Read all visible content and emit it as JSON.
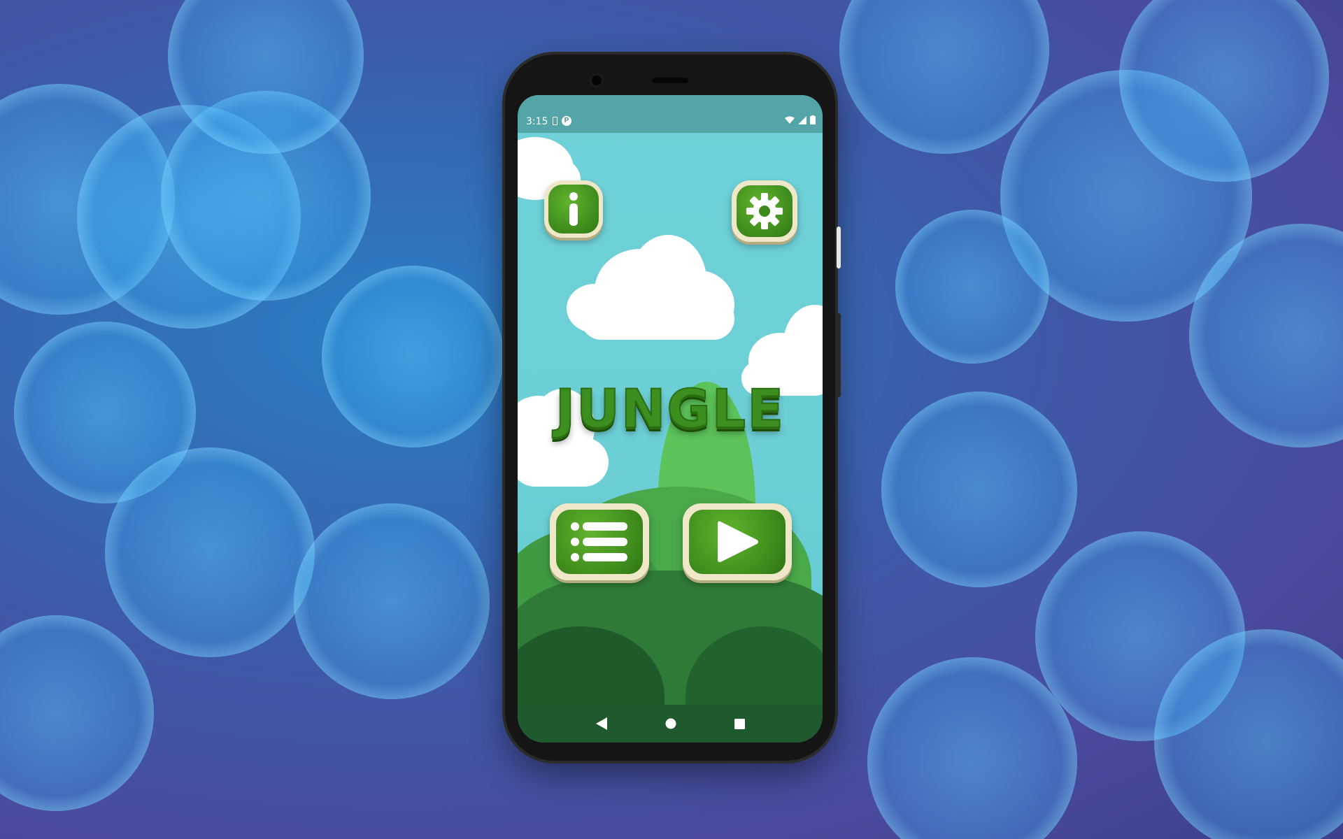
{
  "status_bar": {
    "time": "3:15",
    "notification_badge": "P"
  },
  "game": {
    "title": "JUNGLE",
    "buttons": {
      "info": "info-icon",
      "settings": "gear-icon",
      "levels": "list-icon",
      "play": "play-icon"
    }
  },
  "nav_bar": {
    "back": "back-triangle-icon",
    "home": "home-circle-icon",
    "recents": "recents-square-icon"
  },
  "colors": {
    "sky": "#6fd0d8",
    "button_green": "#3d8a1c",
    "button_frame": "#efe8c8",
    "nav_bar": "#1e5a2e"
  }
}
